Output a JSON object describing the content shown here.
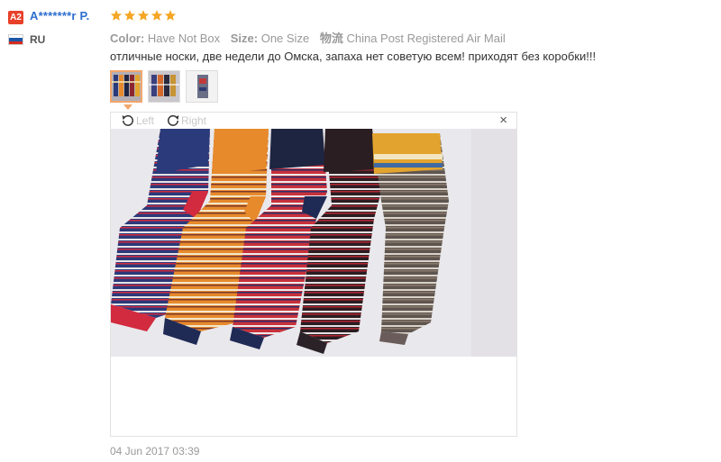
{
  "reviewer": {
    "avatar_text": "A2",
    "name": "A*******r P.",
    "country": "RU",
    "rating_stars": 5,
    "star_color": "#f5a623"
  },
  "attributes": [
    {
      "key": "Color:",
      "value": "Have Not Box"
    },
    {
      "key": "Size:",
      "value": "One Size"
    },
    {
      "key": "物流",
      "value": "China Post Registered Air Mail"
    }
  ],
  "review": {
    "text": "отличные носки, две недели до Омска, запаха нет советую всем! приходят без коробки!!!",
    "date": "04 Jun 2017 03:39"
  },
  "viewer": {
    "rotate_left_label": "Left",
    "rotate_right_label": "Right",
    "close_label": "×"
  },
  "photo": {
    "background": "#e9e8ec",
    "socks": [
      {
        "name": "blue-red striped sock",
        "top": "#2b3a7a",
        "bottom": "#d22a3f"
      },
      {
        "name": "orange striped sock",
        "top": "#e78a2c",
        "bottom": "#1f2a55"
      },
      {
        "name": "navy white striped sock",
        "top": "#1e2541",
        "bottom": "#1f2a55"
      },
      {
        "name": "black red striped sock",
        "top": "#2a1e22",
        "bottom": "#2a2227"
      },
      {
        "name": "brown gold striped sock",
        "top": "#e2a42e",
        "bottom": "#5a4c4a"
      }
    ]
  },
  "colors": {
    "accent_name": "#2d6ecf",
    "avatar_bg": "#e8402a",
    "thumb_active": "#f2a66b"
  }
}
